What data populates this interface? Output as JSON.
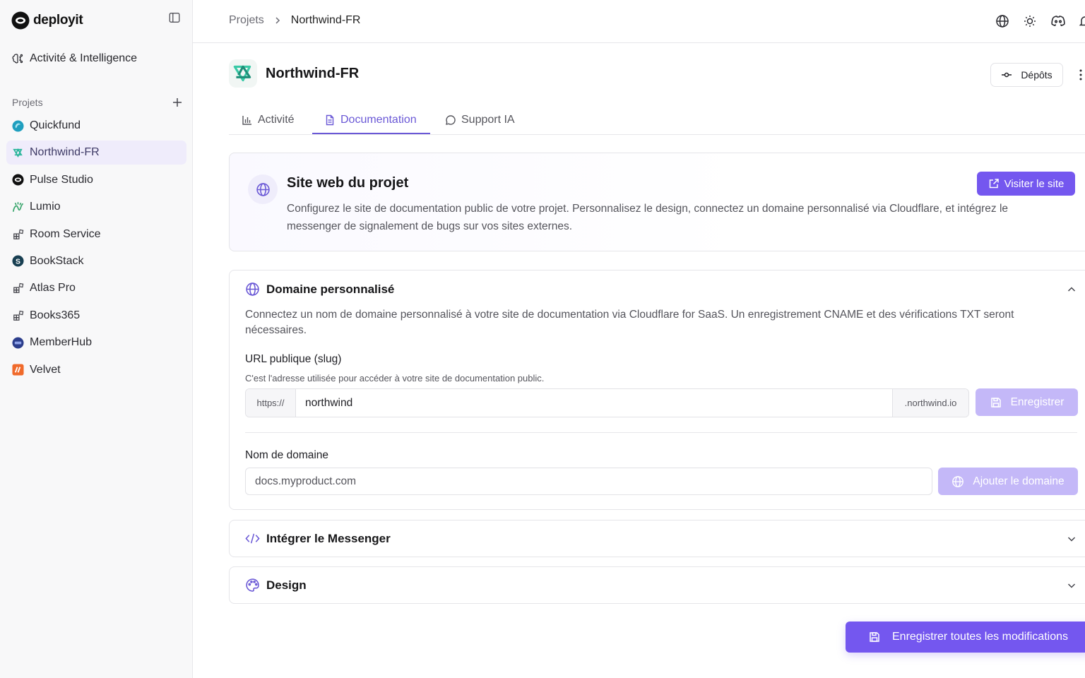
{
  "brand": {
    "name": "deployit"
  },
  "sidebar": {
    "activity_label": "Activité & Intelligence",
    "projects_title": "Projets",
    "projects": [
      {
        "label": "Quickfund",
        "icon": "quickfund-logo-icon",
        "color": "#1f9fbf"
      },
      {
        "label": "Northwind-FR",
        "icon": "northwind-logo-icon",
        "color": "#28b59a"
      },
      {
        "label": "Pulse Studio",
        "icon": "pulse-logo-icon",
        "color": "#111111"
      },
      {
        "label": "Lumio",
        "icon": "lumio-logo-icon",
        "color": "#3ba66e"
      },
      {
        "label": "Room Service",
        "icon": "project-grid-icon",
        "color": "#45454c"
      },
      {
        "label": "BookStack",
        "icon": "bookstack-logo-icon",
        "color": "#183f52"
      },
      {
        "label": "Atlas Pro",
        "icon": "project-grid-icon",
        "color": "#45454c"
      },
      {
        "label": "Books365",
        "icon": "project-grid-icon",
        "color": "#45454c"
      },
      {
        "label": "MemberHub",
        "icon": "memberhub-logo-icon",
        "color": "#2c3e8c"
      },
      {
        "label": "Velvet",
        "icon": "velvet-logo-icon",
        "color": "#f06a2b"
      }
    ],
    "active_project": "Northwind-FR"
  },
  "breadcrumb": {
    "root": "Projets",
    "current": "Northwind-FR"
  },
  "header": {
    "title": "Northwind-FR",
    "depots_label": "Dépôts"
  },
  "tabs": [
    {
      "label": "Activité",
      "icon": "bar-chart-icon"
    },
    {
      "label": "Documentation",
      "icon": "document-icon",
      "active": true
    },
    {
      "label": "Support IA",
      "icon": "chat-bubble-icon"
    }
  ],
  "site_card": {
    "title": "Site web du projet",
    "description": "Configurez le site de documentation public de votre projet. Personnalisez le design, connectez un domaine personnalisé via Cloudflare, et intégrez le messenger de signalement de bugs sur vos sites externes.",
    "visit_label": "Visiter le site"
  },
  "domain_card": {
    "title": "Domaine personnalisé",
    "description": "Connectez un nom de domaine personnalisé à votre site de documentation via Cloudflare for SaaS. Un enregistrement CNAME et des vérifications TXT seront nécessaires.",
    "slug_label": "URL publique (slug)",
    "slug_help": "C'est l'adresse utilisée pour accéder à votre site de documentation public.",
    "slug_prefix": "https://",
    "slug_value": "northwind",
    "slug_suffix": ".northwind.io",
    "save_label": "Enregistrer",
    "domain_label": "Nom de domaine",
    "domain_placeholder": "docs.myproduct.com",
    "add_domain_label": "Ajouter le domaine"
  },
  "messenger_card": {
    "title": "Intégrer le Messenger"
  },
  "design_card": {
    "title": "Design"
  },
  "save_all_label": "Enregistrer toutes les modifications",
  "colors": {
    "accent": "#7457ef",
    "accent_disabled": "#c4b8f8",
    "active_tab": "#6a58d6"
  }
}
